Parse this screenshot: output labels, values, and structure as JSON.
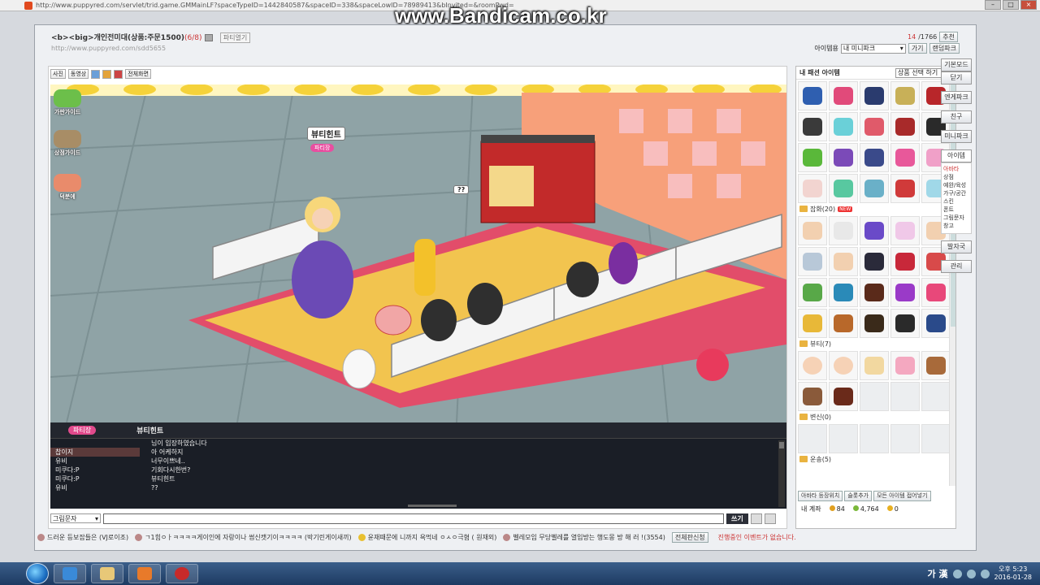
{
  "browser": {
    "url": "http://www.puppyred.com/servlet/trid.game.GMMainLF?spaceTypeID=1442840587&spaceID=338&spaceLowID=78989413&bInvited=&roomPwd="
  },
  "watermark": "www.Bandicam.co.kr",
  "popup": {
    "title_prefix": "<b><big>",
    "title": "개인전미대(상품:주문1500)",
    "title_count": "(6/8)",
    "party_btn": "파티열기",
    "url": "http://www.puppyred.com/sdd5655",
    "counter_current": "14",
    "counter_total": "/1766",
    "counter_btn": "추천",
    "item_label": "아이템용",
    "minipark_select": "내 미니파크",
    "go_btn": "가기",
    "random_btn": "랜덤파크"
  },
  "game": {
    "toolbar": {
      "photo": "사진",
      "video": "동영상",
      "fullscreen": "전체화면"
    },
    "side": [
      "가판가이드",
      "상점가이드",
      "덕분에"
    ],
    "speech_name": "뷰티힌트",
    "nametag": "파티장",
    "question": "??"
  },
  "chat": {
    "badge": "파티장",
    "current": "뷰티힌트",
    "rows": [
      {
        "name": "",
        "msg": "님이 입장하였습니다"
      },
      {
        "name": "찹이지",
        "msg": "아 어케하지"
      },
      {
        "name": "유비",
        "msg": "너무이쁘네.."
      },
      {
        "name": "미쿠다:P",
        "msg": "기회다시한번?"
      },
      {
        "name": "미쿠다:P",
        "msg": "뷰티힌트"
      },
      {
        "name": "유비",
        "msg": "??"
      }
    ],
    "input_select": "그림문자",
    "write_btn": "쓰기"
  },
  "items": {
    "title": "내 패션 아이템",
    "sort_select": "상품 선택 하기",
    "sections": [
      {
        "label": "잡화(20)",
        "new": "NEW"
      },
      {
        "label": "뷰티(7)"
      },
      {
        "label": "변신(0)"
      },
      {
        "label": "운송(5)"
      }
    ],
    "foot": {
      "avatar_btn": "아바타 등장위치",
      "add_btn": "슬롯추가",
      "all_btn": "모든 아이템 접어넣기"
    },
    "account_label": "내 계좌",
    "money1": "84",
    "money2": "4,764",
    "money3": "0"
  },
  "rmenu": {
    "basic_mode": "기본모드",
    "close": "닫기",
    "buttons": [
      "엔게파크",
      "친구",
      "미니파크",
      "아이템"
    ],
    "list": [
      "아바타",
      "상점",
      "예완/육성",
      "가구/공간",
      "스킨",
      "폰트",
      "그림문자",
      "창고"
    ],
    "footprint": "발자국",
    "manage": "관리"
  },
  "ticker": {
    "items": [
      "드러운 등보잡들은 (VJ로이조)",
      "ㄱ1힘ㅇㅏㅋㅋㅋㅋ게이인에 자랑이나 썸신캣기이ㅋㅋㅋㅋ (박기린게이새끼)",
      "윤재때문에 니까지 욕먹네 ㅇㅅㅇ극혐 ( 원재외)",
      "벨레모임 무당벨레를 열입방는 행도몽 방 해 러 !(3554)"
    ],
    "board_btn": "전체판신청",
    "event": "진행중인 이벤트가 없습니다."
  },
  "taskbar": {
    "ime": "가 漢",
    "time": "오후 5:23",
    "date": "2016-01-28"
  },
  "colors": {
    "floor_yellow": "#f2c44f",
    "border_pink": "#e24d6a",
    "chat_bg": "#1a1e26",
    "accent_red": "#cc3333"
  }
}
